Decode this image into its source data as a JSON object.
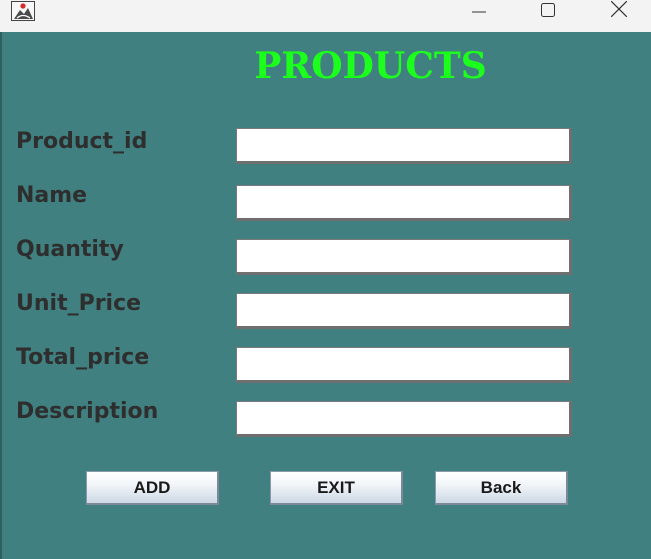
{
  "window": {
    "controls": {
      "minimize_icon": "minimize-icon",
      "maximize_icon": "maximize-icon",
      "close_icon": "close-icon"
    },
    "app_icon": "java-app-icon"
  },
  "form": {
    "title": "PRODUCTS",
    "fields": [
      {
        "label": "Product_id",
        "value": ""
      },
      {
        "label": "Name",
        "value": ""
      },
      {
        "label": "Quantity",
        "value": ""
      },
      {
        "label": "Unit_Price",
        "value": ""
      },
      {
        "label": "Total_price",
        "value": ""
      },
      {
        "label": "Description",
        "value": ""
      }
    ],
    "buttons": {
      "add": "ADD",
      "exit": "EXIT",
      "back": "Back"
    }
  },
  "colors": {
    "background": "#418080",
    "title": "#1cff1c",
    "label": "#2e2e2e"
  }
}
